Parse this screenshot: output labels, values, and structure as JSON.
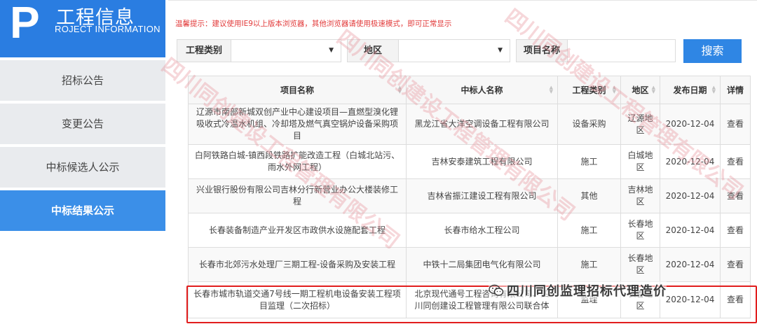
{
  "logo": {
    "letter": "P",
    "title_zh": "工程信息",
    "title_en": "ROJECT INFORMATION"
  },
  "menu": [
    {
      "label": "招标公告",
      "active": false
    },
    {
      "label": "变更公告",
      "active": false
    },
    {
      "label": "中标候选人公示",
      "active": false
    },
    {
      "label": "中标结果公示",
      "active": true
    }
  ],
  "notice": "温馨提示：建议使用IE9以上版本浏览器，其他浏览器请使用极速模式，即可正常显示",
  "filters": {
    "category_label": "工程类别",
    "category_value": "",
    "region_label": "地区",
    "region_value": "",
    "project_label": "项目名称",
    "project_value": "",
    "search_label": "搜索"
  },
  "table": {
    "headers": [
      "项目名称",
      "中标人名称",
      "工程类别",
      "地区",
      "发布日期",
      "详情"
    ],
    "rows": [
      {
        "project": "辽源市南部新城双创产业中心建设项目—直燃型溴化锂吸收式冷温水机组、冷却塔及燃气真空锅炉设备采购项目",
        "winner": "黑龙江省大洋空调设备工程有限公司",
        "category": "设备采购",
        "region": "辽源地区",
        "date": "2020-12-04",
        "detail": "查看"
      },
      {
        "project": "白阿铁路白城-镇西段铁路扩能改造工程（白城北站污、雨水外网工程）",
        "winner": "吉林安泰建筑工程有限公司",
        "category": "施工",
        "region": "白城地区",
        "date": "2020-12-04",
        "detail": "查看"
      },
      {
        "project": "兴业银行股份有限公司吉林分行新营业办公大楼装修工程",
        "winner": "吉林省振江建设工程有限公司",
        "category": "其他",
        "region": "吉林地区",
        "date": "2020-12-04",
        "detail": "查看"
      },
      {
        "project": "长春装备制造产业开发区市政供水设施配套工程",
        "winner": "长春市给水工程公司",
        "category": "施工",
        "region": "长春地区",
        "date": "2020-12-04",
        "detail": "查看"
      },
      {
        "project": "长春市北郊污水处理厂三期工程-设备采购及安装工程",
        "winner": "中铁十二局集团电气化有限公司",
        "category": "施工",
        "region": "长春地区",
        "date": "2020-12-04",
        "detail": "查看"
      },
      {
        "project": "长春市城市轨道交通7号线一期工程机电设备安装工程项目监理（二次招标）",
        "winner": "北京现代通号工程咨询有限公司、四川同创建设工程管理有限公司联合体",
        "category": "监理",
        "region": "长春地区",
        "date": "2020-12-04",
        "detail": "查看"
      }
    ]
  },
  "wechat_badge": "四川同创监理招标代理造价",
  "watermark_text": "四川同创建设工程管理有限公司",
  "colors": {
    "brand_blue": "#2a7de1",
    "active_menu": "#3b8fe8",
    "notice_red": "#e23a3a",
    "highlight_red": "#e11d1d"
  }
}
